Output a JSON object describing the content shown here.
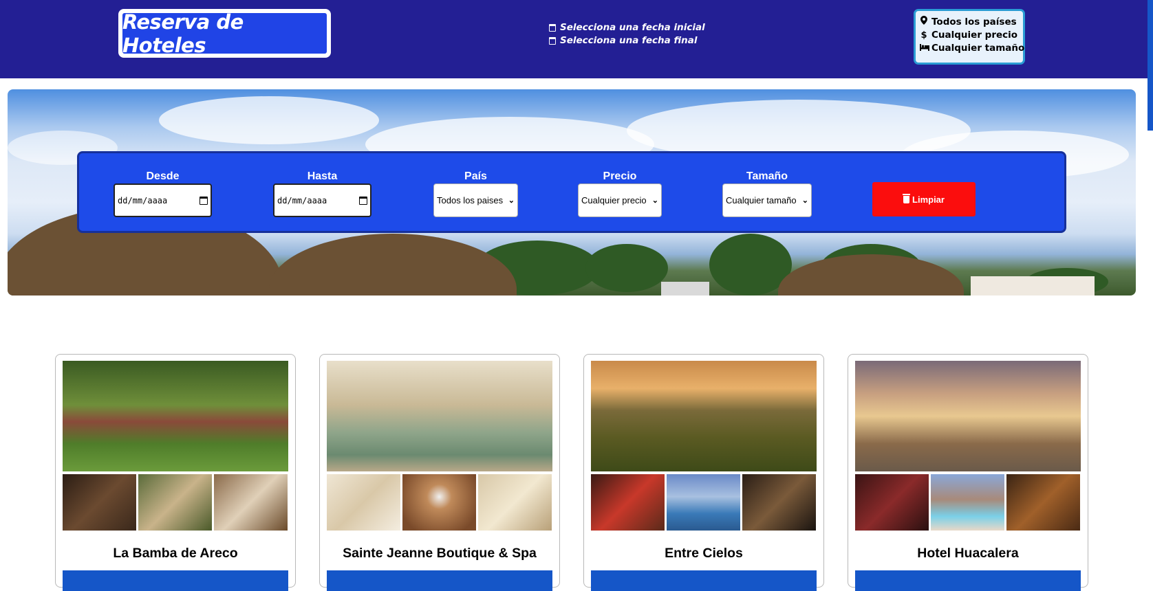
{
  "header": {
    "logo_text": "Reserva de Hoteles",
    "date_from_text": "Selecciona una fecha inicial",
    "date_to_text": "Selecciona una fecha final",
    "summary": {
      "country": "Todos los países",
      "price": "Cualquier precio",
      "size": "Cualquier tamaño"
    }
  },
  "search": {
    "from_label": "Desde",
    "from_value": "dd/mm/aaaa",
    "to_label": "Hasta",
    "to_value": "dd/mm/aaaa",
    "country_label": "País",
    "country_value": "Todos los paises",
    "price_label": "Precio",
    "price_value": "Cualquier precio",
    "size_label": "Tamaño",
    "size_value": "Cualquier tamaño",
    "clear_label": "Limpiar"
  },
  "hotels": [
    {
      "name": "La Bamba de Areco"
    },
    {
      "name": "Sainte Jeanne Boutique & Spa"
    },
    {
      "name": "Entre Cielos"
    },
    {
      "name": "Hotel Huacalera"
    }
  ],
  "colors": {
    "header_bg": "#231f94",
    "search_bg": "#1e4be9",
    "clear_button": "#fb0d0d",
    "accent_blue": "#1556c8"
  }
}
